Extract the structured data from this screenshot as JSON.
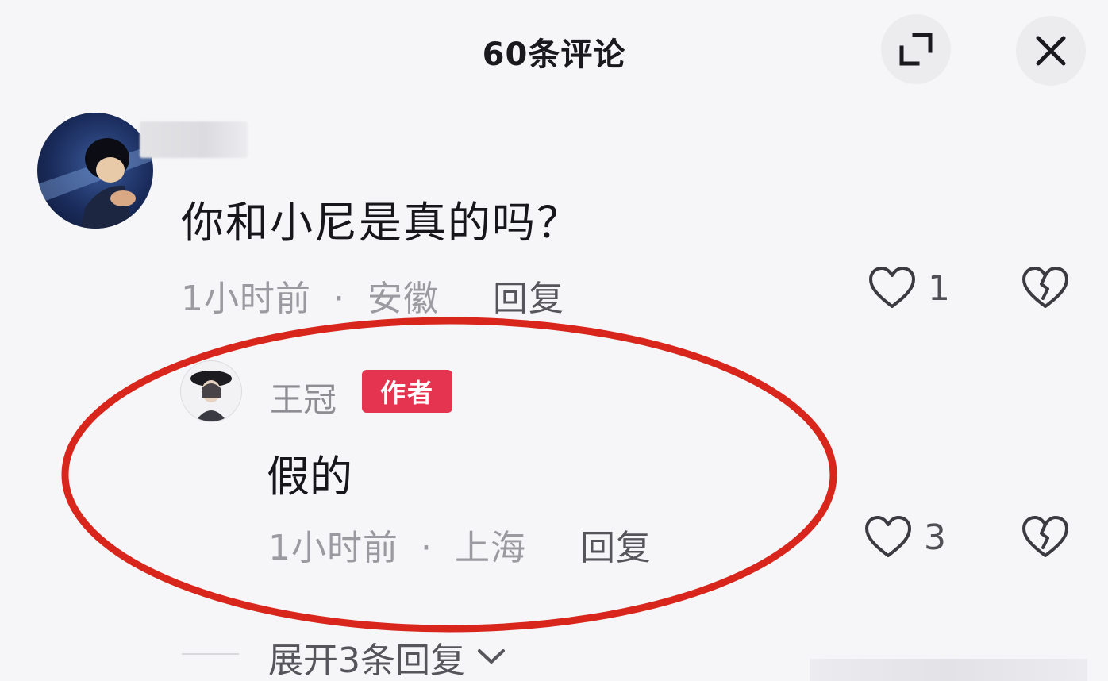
{
  "header": {
    "title": "60条评论",
    "expand_icon": "expand-icon",
    "close_icon": "close-icon"
  },
  "comments": [
    {
      "avatar": "user-avatar",
      "username": "",
      "text": "你和小尼是真的吗？",
      "time": "1小时前",
      "separator": "·",
      "location": "安徽",
      "reply_label": "回复",
      "like_count": "1",
      "like_icon": "heart-outline-icon",
      "dislike_icon": "broken-heart-icon"
    },
    {
      "avatar": "author-avatar",
      "username": "王冠",
      "badge": "作者",
      "text": "假的",
      "time": "1小时前",
      "separator": "·",
      "location": "上海",
      "reply_label": "回复",
      "like_count": "3",
      "like_icon": "heart-outline-icon",
      "dislike_icon": "broken-heart-icon"
    }
  ],
  "expand_replies": {
    "label": "展开3条回复",
    "icon": "chevron-down-icon"
  },
  "annotation_color": "#d9261c"
}
